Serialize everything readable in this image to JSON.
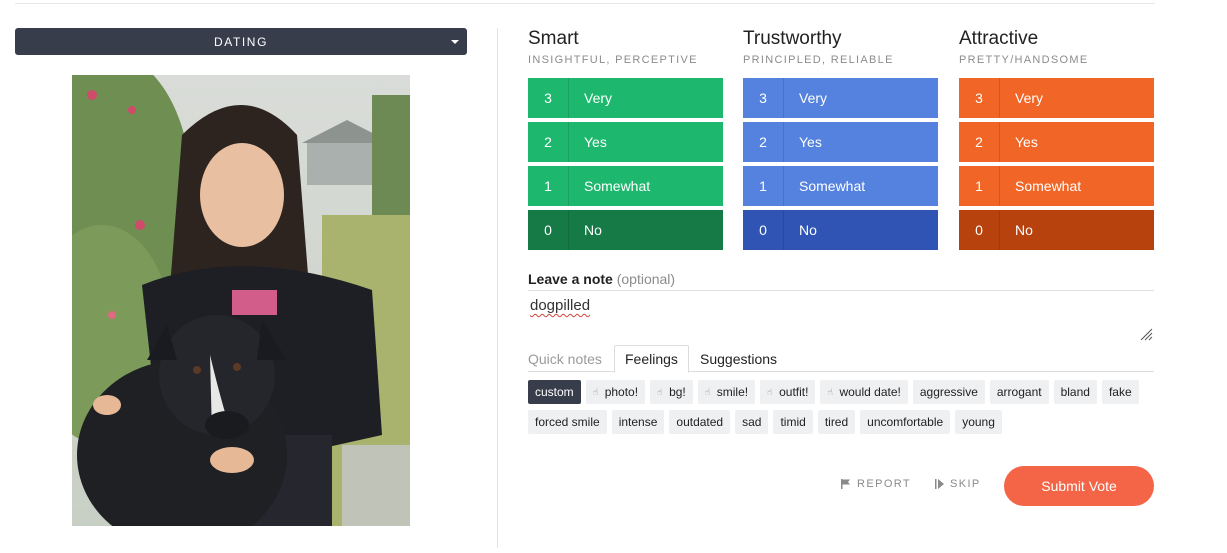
{
  "category": {
    "label": "DATING"
  },
  "ratings": [
    {
      "title": "Smart",
      "subtitle": "INSIGHTFUL, PERCEPTIVE",
      "color": "#1db86e",
      "selected_color": "#157a45",
      "options": [
        {
          "value": "3",
          "label": "Very"
        },
        {
          "value": "2",
          "label": "Yes"
        },
        {
          "value": "1",
          "label": "Somewhat"
        },
        {
          "value": "0",
          "label": "No"
        }
      ],
      "selected": "0"
    },
    {
      "title": "Trustworthy",
      "subtitle": "PRINCIPLED, RELIABLE",
      "color": "#5482de",
      "selected_color": "#2f54b4",
      "options": [
        {
          "value": "3",
          "label": "Very"
        },
        {
          "value": "2",
          "label": "Yes"
        },
        {
          "value": "1",
          "label": "Somewhat"
        },
        {
          "value": "0",
          "label": "No"
        }
      ],
      "selected": "0"
    },
    {
      "title": "Attractive",
      "subtitle": "PRETTY/HANDSOME",
      "color": "#f16526",
      "selected_color": "#b8420e",
      "options": [
        {
          "value": "3",
          "label": "Very"
        },
        {
          "value": "2",
          "label": "Yes"
        },
        {
          "value": "1",
          "label": "Somewhat"
        },
        {
          "value": "0",
          "label": "No"
        }
      ],
      "selected": "0"
    }
  ],
  "note": {
    "label": "Leave a note",
    "optional": "(optional)",
    "value": "dogpilled"
  },
  "tabs": {
    "quick": "Quick notes",
    "feelings": "Feelings",
    "suggestions": "Suggestions"
  },
  "chips_row1": [
    {
      "label": "custom",
      "active": true,
      "thumb": false
    },
    {
      "label": "photo!",
      "active": false,
      "thumb": true
    },
    {
      "label": "bg!",
      "active": false,
      "thumb": true
    },
    {
      "label": "smile!",
      "active": false,
      "thumb": true
    },
    {
      "label": "outfit!",
      "active": false,
      "thumb": true
    },
    {
      "label": "would date!",
      "active": false,
      "thumb": true
    },
    {
      "label": "aggressive",
      "active": false,
      "thumb": false
    },
    {
      "label": "arrogant",
      "active": false,
      "thumb": false
    },
    {
      "label": "bland",
      "active": false,
      "thumb": false
    },
    {
      "label": "fake",
      "active": false,
      "thumb": false
    }
  ],
  "chips_row2": [
    {
      "label": "forced smile",
      "active": false,
      "thumb": false
    },
    {
      "label": "intense",
      "active": false,
      "thumb": false
    },
    {
      "label": "outdated",
      "active": false,
      "thumb": false
    },
    {
      "label": "sad",
      "active": false,
      "thumb": false
    },
    {
      "label": "timid",
      "active": false,
      "thumb": false
    },
    {
      "label": "tired",
      "active": false,
      "thumb": false
    },
    {
      "label": "uncomfortable",
      "active": false,
      "thumb": false
    },
    {
      "label": "young",
      "active": false,
      "thumb": false
    }
  ],
  "actions": {
    "report": "REPORT",
    "skip": "SKIP",
    "submit": "Submit Vote"
  }
}
